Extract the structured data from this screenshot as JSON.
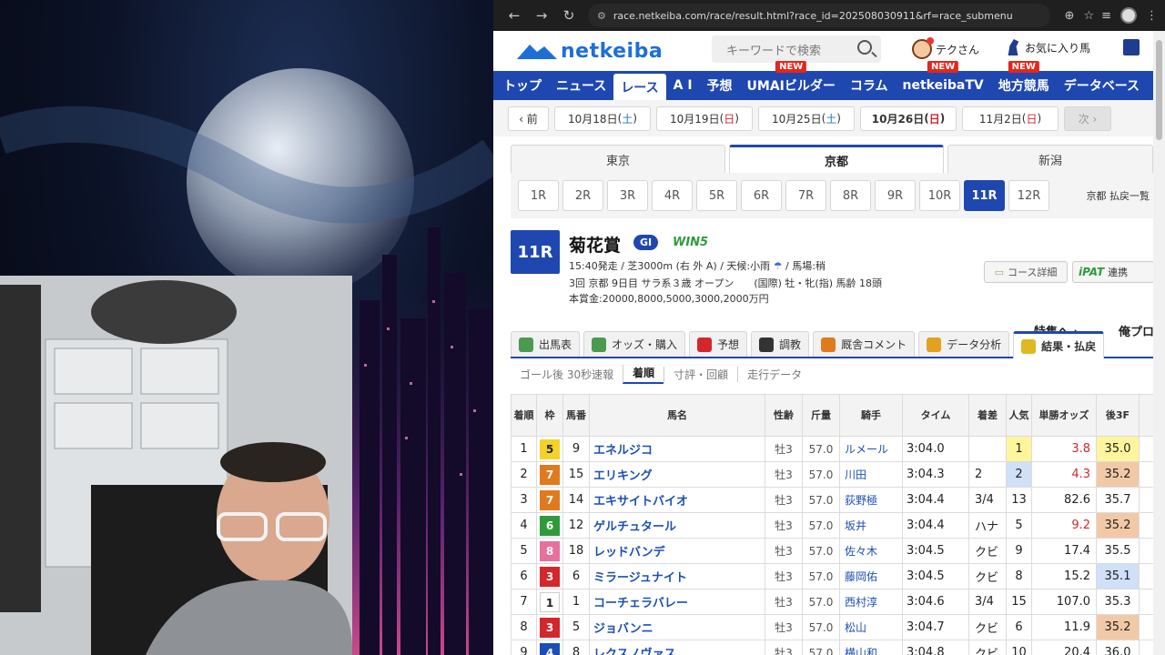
{
  "browser": {
    "url": "race.netkeiba.com/race/result.html?race_id=202508030911&rf=race_submenu"
  },
  "site": {
    "logo_text": "netkeiba",
    "search_placeholder": "キーワードで検索",
    "user_label": "テクさん",
    "favorites_label": "お気に入り馬"
  },
  "nav": [
    {
      "label": "トップ",
      "badge": ""
    },
    {
      "label": "ニュース",
      "badge": ""
    },
    {
      "label": "レース",
      "badge": "",
      "active": true
    },
    {
      "label": "A I",
      "badge": ""
    },
    {
      "label": "予想",
      "badge": ""
    },
    {
      "label": "UMAIビルダー",
      "badge": "NEW"
    },
    {
      "label": "コラム",
      "badge": ""
    },
    {
      "label": "netkeibaTV",
      "badge": "NEW"
    },
    {
      "label": "地方競馬",
      "badge": "NEW"
    },
    {
      "label": "データベース",
      "badge": ""
    }
  ],
  "dates": {
    "prev_label": "‹ 前",
    "next_label": "次 ›",
    "items": [
      {
        "md": "10月18日",
        "dow": "土",
        "type": "sat"
      },
      {
        "md": "10月19日",
        "dow": "日",
        "type": "sun"
      },
      {
        "md": "10月25日",
        "dow": "土",
        "type": "sat"
      },
      {
        "md": "10月26日",
        "dow": "日",
        "type": "sun",
        "active": true
      },
      {
        "md": "11月2日",
        "dow": "日",
        "type": "sun"
      }
    ]
  },
  "venues": [
    {
      "label": "東京"
    },
    {
      "label": "京都",
      "active": true
    },
    {
      "label": "新潟"
    }
  ],
  "races": [
    "1R",
    "2R",
    "3R",
    "4R",
    "5R",
    "6R",
    "7R",
    "8R",
    "9R",
    "10R",
    "11R",
    "12R"
  ],
  "active_race": "11R",
  "payout_list_label": "京都 払戻一覧",
  "race": {
    "number": "11R",
    "name": "菊花賞",
    "grade": "GI",
    "win5": "WIN5",
    "data1": "15:40発走 / 芝3000m (右 外 A) / 天候:小雨",
    "data1b": "/ 馬場:稍",
    "data2": "3回 京都 9日目 サラ系３歳 オープン　　(国際) 牡・牝(指) 馬齢 18頭",
    "data3": "本賞金:20000,8000,5000,3000,2000万円",
    "course_btn": "コース詳細",
    "ipat_logo": "iPAT",
    "ipat_btn": "連携",
    "feature_link": "特集へ ›",
    "pro_link": "俺プロへ"
  },
  "race_tabs": [
    {
      "label": "出馬表",
      "color": "#4c9a4f"
    },
    {
      "label": "オッズ・購入",
      "color": "#4c9a4f"
    },
    {
      "label": "予想",
      "color": "#d3272b"
    },
    {
      "label": "調教",
      "color": "#333333"
    },
    {
      "label": "厩舎コメント",
      "color": "#e07a1f"
    },
    {
      "label": "データ分析",
      "color": "#e0a21f"
    },
    {
      "label": "結果・払戻",
      "color": "#e0b81f",
      "active": true
    }
  ],
  "sub_tabs": [
    {
      "label": "ゴール後 30秒速報"
    },
    {
      "label": "着順",
      "active": true
    },
    {
      "label": "寸評・回顧"
    },
    {
      "label": "走行データ"
    }
  ],
  "table": {
    "headers": [
      "着順",
      "枠",
      "馬番",
      "馬名",
      "性齢",
      "斤量",
      "騎手",
      "タイム",
      "着差",
      "人気",
      "単勝オッズ",
      "後3F"
    ],
    "rows": [
      {
        "rank": "1",
        "waku": "5",
        "num": "9",
        "horse": "エネルジコ",
        "sexage": "牡3",
        "weight": "57.0",
        "jockey": "ルメール",
        "time": "3:04.0",
        "margin": "",
        "pop": "1",
        "odds": "3.8",
        "last3f": "35.0",
        "fav": true,
        "pop_hl": "#fff59d",
        "f3_hl": "#fff59d"
      },
      {
        "rank": "2",
        "waku": "7",
        "num": "15",
        "horse": "エリキング",
        "sexage": "牡3",
        "weight": "57.0",
        "jockey": "川田",
        "time": "3:04.3",
        "margin": "2",
        "pop": "2",
        "odds": "4.3",
        "last3f": "35.2",
        "fav": true,
        "pop_hl": "#cfe0f7",
        "f3_hl": "#f2c9a7"
      },
      {
        "rank": "3",
        "waku": "7",
        "num": "14",
        "horse": "エキサイトバイオ",
        "sexage": "牡3",
        "weight": "57.0",
        "jockey": "荻野極",
        "time": "3:04.4",
        "margin": "3/4",
        "pop": "13",
        "odds": "82.6",
        "last3f": "35.7",
        "fav": false,
        "pop_hl": "",
        "f3_hl": ""
      },
      {
        "rank": "4",
        "waku": "6",
        "num": "12",
        "horse": "ゲルチュタール",
        "sexage": "牡3",
        "weight": "57.0",
        "jockey": "坂井",
        "time": "3:04.4",
        "margin": "ハナ",
        "pop": "5",
        "odds": "9.2",
        "last3f": "35.2",
        "fav": true,
        "pop_hl": "",
        "f3_hl": "#f2c9a7"
      },
      {
        "rank": "5",
        "waku": "8",
        "num": "18",
        "horse": "レッドバンデ",
        "sexage": "牡3",
        "weight": "57.0",
        "jockey": "佐々木",
        "time": "3:04.5",
        "margin": "クビ",
        "pop": "9",
        "odds": "17.4",
        "last3f": "35.5",
        "fav": false,
        "pop_hl": "",
        "f3_hl": ""
      },
      {
        "rank": "6",
        "waku": "3",
        "num": "6",
        "horse": "ミラージュナイト",
        "sexage": "牡3",
        "weight": "57.0",
        "jockey": "藤岡佑",
        "time": "3:04.5",
        "margin": "クビ",
        "pop": "8",
        "odds": "15.2",
        "last3f": "35.1",
        "fav": false,
        "pop_hl": "",
        "f3_hl": "#cfe0f7"
      },
      {
        "rank": "7",
        "waku": "1",
        "num": "1",
        "horse": "コーチェラバレー",
        "sexage": "牡3",
        "weight": "57.0",
        "jockey": "西村淳",
        "time": "3:04.6",
        "margin": "3/4",
        "pop": "15",
        "odds": "107.0",
        "last3f": "35.3",
        "fav": false,
        "pop_hl": "",
        "f3_hl": ""
      },
      {
        "rank": "8",
        "waku": "3",
        "num": "5",
        "horse": "ジョバンニ",
        "sexage": "牡3",
        "weight": "57.0",
        "jockey": "松山",
        "time": "3:04.7",
        "margin": "クビ",
        "pop": "6",
        "odds": "11.9",
        "last3f": "35.2",
        "fav": false,
        "pop_hl": "",
        "f3_hl": "#f2c9a7"
      },
      {
        "rank": "9",
        "waku": "4",
        "num": "8",
        "horse": "レクスノヴァス",
        "sexage": "牡3",
        "weight": "57.0",
        "jockey": "横山和",
        "time": "3:04.8",
        "margin": "クビ",
        "pop": "10",
        "odds": "20.4",
        "last3f": "36.0",
        "fav": false,
        "pop_hl": "",
        "f3_hl": ""
      }
    ]
  },
  "waku_colors": {
    "1": {
      "bg": "#ffffff",
      "fg": "#222222"
    },
    "2": {
      "bg": "#222222",
      "fg": "#ffffff"
    },
    "3": {
      "bg": "#d3272b",
      "fg": "#ffffff"
    },
    "4": {
      "bg": "#1b4fb7",
      "fg": "#ffffff"
    },
    "5": {
      "bg": "#f5d22a",
      "fg": "#222222"
    },
    "6": {
      "bg": "#2e9b3b",
      "fg": "#ffffff"
    },
    "7": {
      "bg": "#e07a1f",
      "fg": "#ffffff"
    },
    "8": {
      "bg": "#e8709a",
      "fg": "#ffffff"
    }
  },
  "colors": {
    "brand_blue": "#1f47b0",
    "new_badge": "#e5261b"
  }
}
